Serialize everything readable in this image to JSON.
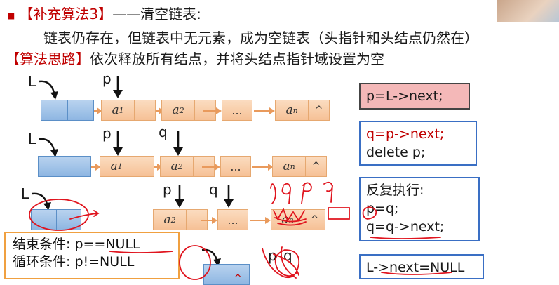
{
  "title": {
    "bullet": "■",
    "tag": "【补充算法3】",
    "text": "——清空链表:"
  },
  "description": "链表仍存在，但链表中无元素，成为空链表（头指针和头结点仍然在）",
  "idea": {
    "tag": "【算法思路】",
    "text": "依次释放所有结点，并将头结点指针域设置为空"
  },
  "labels": {
    "L": "L",
    "p": "p",
    "q": "q"
  },
  "nodes": {
    "a1": "a",
    "s1": "1",
    "a2": "a",
    "s2": "2",
    "an": "a",
    "sn": "n",
    "null_sym": "^",
    "ellipsis": "..."
  },
  "code": {
    "step1": "p=L->next;",
    "step2_line1": "q=p->next;",
    "step2_line2": "delete p;",
    "step3_head": "反复执行:",
    "step3_line1": "p=q;",
    "step3_line2": "q=q->next;",
    "step4": "L->next=NULL"
  },
  "conditions": {
    "end": "结束条件:  p==NULL",
    "loop": "循环条件:  p!=NULL"
  },
  "colors": {
    "accent_red": "#c00000",
    "head_blue": "#8eb6e2",
    "node_orange": "#f6c196",
    "box_blue": "#3a6fc4"
  }
}
